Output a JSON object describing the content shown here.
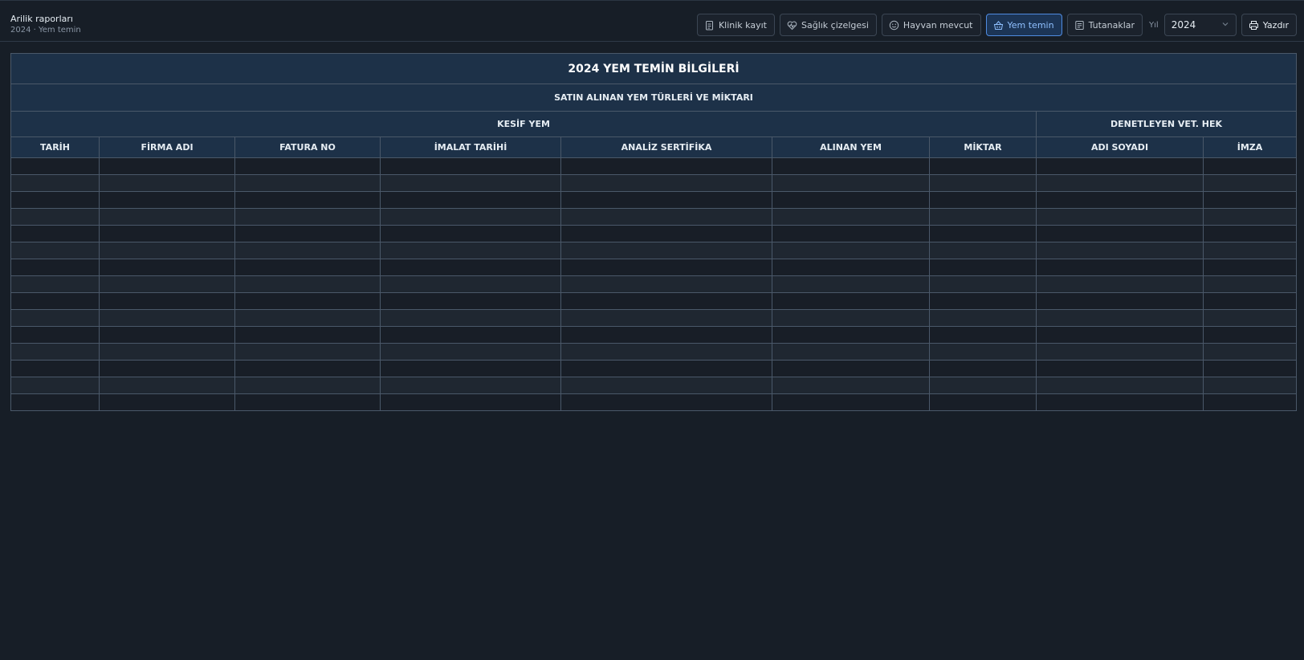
{
  "header": {
    "title": "Arilik raporları",
    "subtitle": "2024 · Yem temin"
  },
  "toolbar": {
    "buttons": [
      {
        "label": "Klinik kayıt",
        "icon": "clipboard-icon"
      },
      {
        "label": "Sağlık çizelgesi",
        "icon": "heart-pulse-icon"
      },
      {
        "label": "Hayvan mevcut",
        "icon": "smile-icon"
      },
      {
        "label": "Yem temin",
        "icon": "basket-icon",
        "active": true
      },
      {
        "label": "Tutanaklar",
        "icon": "document-icon"
      }
    ],
    "year_label": "Yıl",
    "year_value": "2024",
    "print_label": "Yazdır"
  },
  "table": {
    "title": "2024 YEM TEMİN BİLGİLERİ",
    "subtitle": "SATIN ALINAN YEM TÜRLERİ VE MİKTARI",
    "group_left": "KESİF YEM",
    "group_right": "DENETLEYEN VET. HEK",
    "columns": [
      "TARİH",
      "FİRMA ADI",
      "FATURA NO",
      "İMALAT TARİHİ",
      "ANALİZ SERTİFİKA",
      "ALINAN YEM",
      "MİKTAR",
      "ADI SOYADI",
      "İMZA"
    ],
    "empty_rows": 15
  },
  "colors": {
    "background": "#171e27",
    "header_cell": "#1d3148",
    "active_accent": "#4f8be0"
  }
}
